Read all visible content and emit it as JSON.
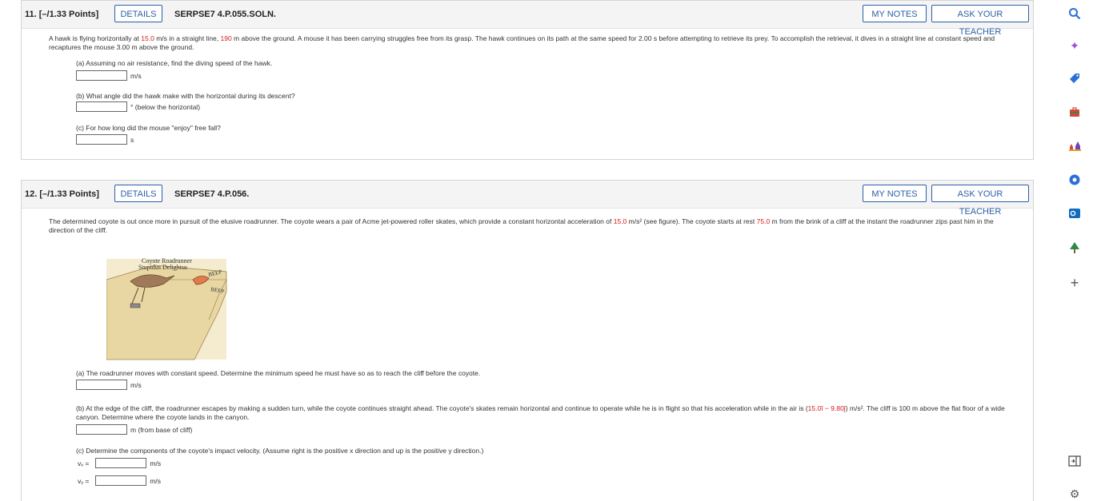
{
  "q11": {
    "number": "11.  [–/1.33 Points]",
    "details_label": "DETAILS",
    "id": "SERPSE7 4.P.055.SOLN.",
    "my_notes_label": "MY NOTES",
    "ask_teacher_label": "ASK YOUR TEACHER",
    "text_1": "A hawk is flying horizontally at ",
    "speed": "15.0",
    "text_2": " m/s in a straight line, ",
    "height": "190",
    "text_3": " m above the ground. A mouse it has been carrying struggles free from its grasp. The hawk continues on its path at the same speed for 2.00 s before attempting to retrieve its prey. To accomplish the retrieval, it dives in a straight line at constant speed and recaptures the mouse 3.00 m above the ground.",
    "part_a": "(a) Assuming no air resistance, find the diving speed of the hawk.",
    "unit_a": "m/s",
    "part_b": "(b) What angle did the hawk make with the horizontal during its descent?",
    "unit_b": "° (below the horizontal)",
    "part_c": "(c) For how long did the mouse \"enjoy\" free fall?",
    "unit_c": "s"
  },
  "q12": {
    "number": "12.  [–/1.33 Points]",
    "details_label": "DETAILS",
    "id": "SERPSE7 4.P.056.",
    "my_notes_label": "MY NOTES",
    "ask_teacher_label": "ASK YOUR TEACHER",
    "text_1": "The determined coyote is out once more in pursuit of the elusive roadrunner. The coyote wears a pair of Acme jet-powered roller skates, which provide a constant horizontal acceleration of ",
    "accel": "15.0",
    "text_2": " m/s² (see figure). The coyote starts at rest ",
    "dist": "75.0",
    "text_3": " m from the brink of a cliff at the instant the roadrunner zips past him in the direction of the cliff.",
    "figure_label_1": "Coyote  Roadrunner",
    "figure_label_2": "Stupidus  Delightus",
    "figure_beep_1": "BEEP",
    "figure_beep_2": "BEEP",
    "part_a": "(a) The roadrunner moves with constant speed. Determine the minimum speed he must have so as to reach the cliff before the coyote.",
    "unit_a": "m/s",
    "part_b_1": "(b) At the edge of the cliff, the roadrunner escapes by making a sudden turn, while the coyote continues straight ahead. The coyote's skates remain horizontal and continue to operate while he is in flight so that his acceleration while in the air is (",
    "part_b_vec": "15.0î − 9.80ĵ",
    "part_b_2": ") m/s². The cliff is 100 m above the flat floor of a wide canyon. Determine where the coyote lands in the canyon.",
    "unit_b": "m (from base of cliff)",
    "part_c": "(c) Determine the components of the coyote's impact velocity. (Assume right is the positive x direction and up is the positive y direction.)",
    "vx_label": "vₓ =",
    "vy_label": "vᵧ =",
    "unit_vx": "m/s",
    "unit_vy": "m/s"
  },
  "sidebar": {
    "icons": [
      "search-icon",
      "sparkle-icon",
      "tag-icon",
      "briefcase-icon",
      "chess-icon",
      "circle-icon",
      "outlook-icon",
      "tree-icon",
      "plus-icon",
      "panel-icon",
      "gear-icon"
    ]
  },
  "colors": {
    "accent": "#2b5fa6",
    "highlight": "#d41c1c"
  }
}
